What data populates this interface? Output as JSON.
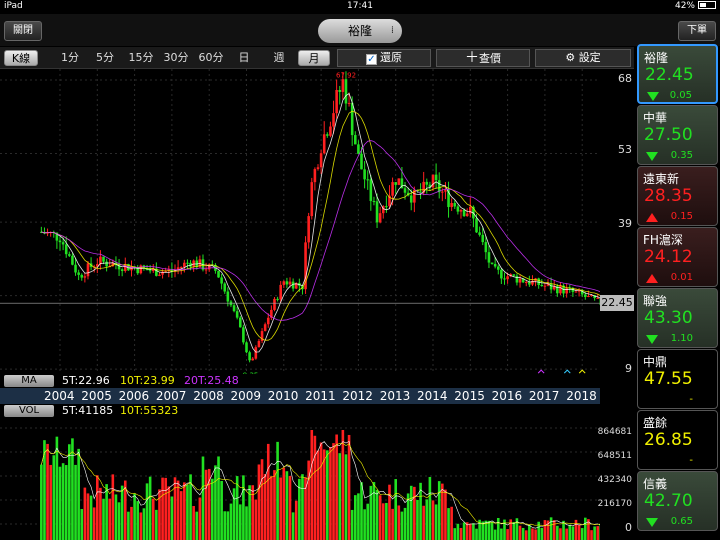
{
  "status_bar": {
    "device": "iPad",
    "time": "17:41",
    "battery": "42%"
  },
  "top_bar": {
    "close_label": "關閉",
    "title": "裕隆",
    "order_label": "下單"
  },
  "toolbar": {
    "k_label": "K線",
    "timeframes": [
      "1分",
      "5分",
      "15分",
      "30分",
      "60分",
      "日",
      "週",
      "月"
    ],
    "selected_timeframe": "月",
    "restore_label": "還原",
    "restore_checked": true,
    "lookup_label": "查價",
    "settings_label": "設定"
  },
  "ma_bar": {
    "tag": "MA",
    "ma5": "5T:22.96",
    "ma10": "10T:23.99",
    "ma20": "20T:25.48"
  },
  "vol_bar": {
    "tag": "VOL",
    "vol5": "5T:41185",
    "vol10": "10T:55323"
  },
  "current_price_label": "22.45",
  "colors": {
    "up": "#ff2020",
    "down": "#21e021",
    "ma5": "#ffffff",
    "ma10": "#f0f000",
    "ma20": "#cc33ff",
    "year_bar": "#1c2f45"
  },
  "chart_data": {
    "type": "candlestick",
    "x_labels": [
      "2004",
      "2005",
      "2006",
      "2007",
      "2008",
      "2009",
      "2010",
      "2011",
      "2012",
      "2013",
      "2014",
      "2015",
      "2016",
      "2017",
      "2018"
    ],
    "price_axis_ticks": [
      "68",
      "53",
      "39",
      "9"
    ],
    "volume_axis_ticks": [
      "864681",
      "648511",
      "432340",
      "216170",
      "0"
    ],
    "max_label": "67.92",
    "min_label": "9.35",
    "last_price": 22.45,
    "price_keypoints": [
      {
        "year": 2003.5,
        "price": 37
      },
      {
        "year": 2004.0,
        "price": 36
      },
      {
        "year": 2004.5,
        "price": 28
      },
      {
        "year": 2005.0,
        "price": 31
      },
      {
        "year": 2005.8,
        "price": 30
      },
      {
        "year": 2006.5,
        "price": 29
      },
      {
        "year": 2007.0,
        "price": 29
      },
      {
        "year": 2007.5,
        "price": 31
      },
      {
        "year": 2008.2,
        "price": 29
      },
      {
        "year": 2008.8,
        "price": 18
      },
      {
        "year": 2009.1,
        "price": 10
      },
      {
        "year": 2009.6,
        "price": 20
      },
      {
        "year": 2010.0,
        "price": 27
      },
      {
        "year": 2010.5,
        "price": 26
      },
      {
        "year": 2010.7,
        "price": 45
      },
      {
        "year": 2011.0,
        "price": 55
      },
      {
        "year": 2011.6,
        "price": 67.9
      },
      {
        "year": 2012.0,
        "price": 52
      },
      {
        "year": 2012.5,
        "price": 40
      },
      {
        "year": 2013.0,
        "price": 48
      },
      {
        "year": 2013.5,
        "price": 44
      },
      {
        "year": 2014.0,
        "price": 47
      },
      {
        "year": 2014.5,
        "price": 43
      },
      {
        "year": 2015.0,
        "price": 41
      },
      {
        "year": 2015.6,
        "price": 29
      },
      {
        "year": 2016.0,
        "price": 28
      },
      {
        "year": 2016.5,
        "price": 27
      },
      {
        "year": 2017.0,
        "price": 26
      },
      {
        "year": 2017.6,
        "price": 25
      },
      {
        "year": 2018.0,
        "price": 24
      },
      {
        "year": 2018.5,
        "price": 22.45
      }
    ]
  },
  "watchlist": [
    {
      "name": "裕隆",
      "price": "22.45",
      "change": "0.05",
      "dir": "down",
      "selected": true
    },
    {
      "name": "中華",
      "price": "27.50",
      "change": "0.35",
      "dir": "down",
      "selected": false
    },
    {
      "name": "遠東新",
      "price": "28.35",
      "change": "0.15",
      "dir": "up",
      "selected": false
    },
    {
      "name": "FH滬深",
      "price": "24.12",
      "change": "0.01",
      "dir": "up",
      "selected": false
    },
    {
      "name": "聯強",
      "price": "43.30",
      "change": "1.10",
      "dir": "down",
      "selected": false
    },
    {
      "name": "中鼎",
      "price": "47.55",
      "change": "-",
      "dir": "flat",
      "selected": false
    },
    {
      "name": "盛餘",
      "price": "26.85",
      "change": "-",
      "dir": "flat",
      "selected": false
    },
    {
      "name": "信義",
      "price": "42.70",
      "change": "0.65",
      "dir": "down",
      "selected": false
    }
  ]
}
